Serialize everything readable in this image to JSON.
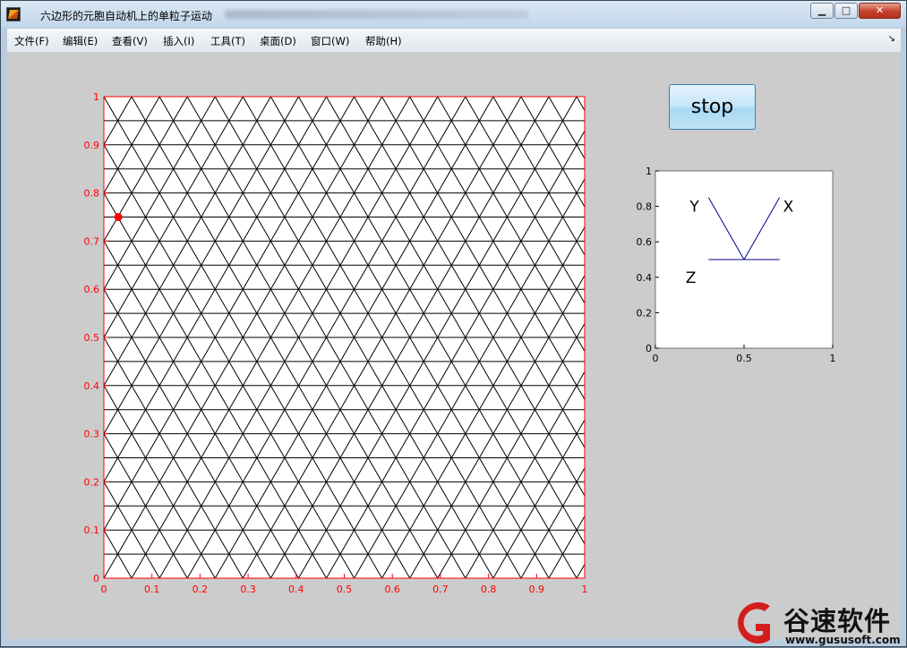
{
  "window": {
    "title": "六边形的元胞自动机上的单粒子运动",
    "controls": {
      "minimize": "▁",
      "maximize": "□",
      "close": "✕"
    }
  },
  "menubar": {
    "items": [
      {
        "id": "file",
        "label": "文件(F)"
      },
      {
        "id": "edit",
        "label": "编辑(E)"
      },
      {
        "id": "view",
        "label": "查看(V)"
      },
      {
        "id": "insert",
        "label": "插入(I)"
      },
      {
        "id": "tools",
        "label": "工具(T)"
      },
      {
        "id": "desktop",
        "label": "桌面(D)"
      },
      {
        "id": "window",
        "label": "窗口(W)"
      },
      {
        "id": "help",
        "label": "帮助(H)"
      }
    ],
    "dock_arrow": "↘"
  },
  "stop_button": {
    "label": "stop"
  },
  "colors": {
    "main_axis": "#ff0000",
    "grid_lines": "#000000",
    "particle": "#ff0000",
    "direction_lines": "#00008b",
    "figure_bg": "#cccccc"
  },
  "chart_data": [
    {
      "type": "scatter",
      "name": "main-lattice",
      "xlim": [
        0,
        1
      ],
      "ylim": [
        0,
        1
      ],
      "x_ticks": [
        "0",
        "0.1",
        "0.2",
        "0.3",
        "0.4",
        "0.5",
        "0.6",
        "0.7",
        "0.8",
        "0.9",
        "1"
      ],
      "y_ticks": [
        "0",
        "0.1",
        "0.2",
        "0.3",
        "0.4",
        "0.5",
        "0.6",
        "0.7",
        "0.8",
        "0.9",
        "1"
      ],
      "lattice": {
        "kind": "triangular",
        "row_spacing": 0.05,
        "horizontal_lines": 20
      },
      "particle": {
        "x": 0.03,
        "y": 0.75
      }
    },
    {
      "type": "line",
      "name": "direction-legend",
      "xlim": [
        0,
        1
      ],
      "ylim": [
        0,
        1
      ],
      "x_ticks": [
        "0",
        "0.5",
        "1"
      ],
      "y_ticks": [
        "0",
        "0.2",
        "0.4",
        "0.6",
        "0.8",
        "1"
      ],
      "segments": [
        {
          "from": [
            0.5,
            0.5
          ],
          "to": [
            0.3,
            0.85
          ]
        },
        {
          "from": [
            0.5,
            0.5
          ],
          "to": [
            0.7,
            0.85
          ]
        },
        {
          "from": [
            0.3,
            0.5
          ],
          "to": [
            0.7,
            0.5
          ]
        }
      ],
      "labels": [
        {
          "text": "Y",
          "x": 0.22,
          "y": 0.8
        },
        {
          "text": "X",
          "x": 0.75,
          "y": 0.8
        },
        {
          "text": "Z",
          "x": 0.2,
          "y": 0.4
        }
      ]
    }
  ],
  "watermark": {
    "brand": "谷速软件",
    "url": "www.gususoft.com"
  }
}
